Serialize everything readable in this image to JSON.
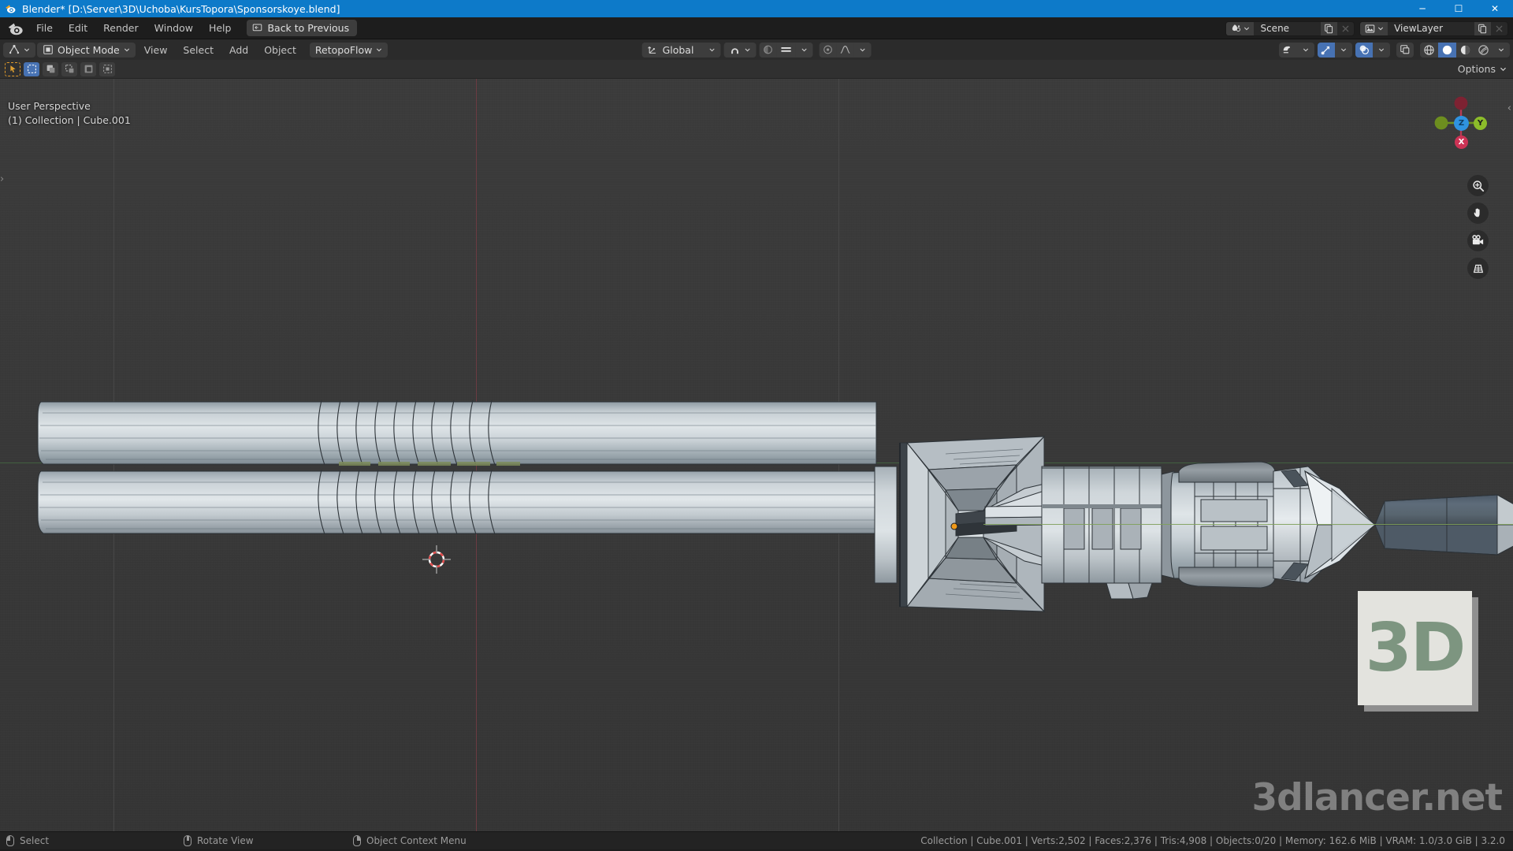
{
  "window": {
    "title": "Blender* [D:\\Server\\3D\\Uchoba\\KursTopora\\Sponsorskoye.blend]",
    "minimize": "─",
    "maximize": "☐",
    "close": "✕"
  },
  "topbar": {
    "menus": [
      "File",
      "Edit",
      "Render",
      "Window",
      "Help"
    ],
    "back_button": "Back to Previous",
    "scene": {
      "value": "Scene",
      "icon": "scene-icon"
    },
    "viewlayer": {
      "value": "ViewLayer",
      "icon": "viewlayer-icon"
    }
  },
  "viewport_header": {
    "mode": "Object Mode",
    "menus": [
      "View",
      "Select",
      "Add",
      "Object"
    ],
    "addon_menu": "RetopoFlow",
    "transform_orientation": "Global",
    "options_label": "Options"
  },
  "viewport": {
    "perspective": "User Perspective",
    "active_object": "(1) Collection | Cube.001",
    "gizmo": {
      "z": "Z",
      "y": "Y",
      "x": "X"
    },
    "nav_icons": [
      "zoom-icon",
      "pan-icon",
      "camera-icon",
      "ortho-persp-icon"
    ]
  },
  "watermark": {
    "logo_text": "3D",
    "site_text": "3dlancer.net"
  },
  "statusbar": {
    "items": [
      {
        "mouse": "left",
        "label": "Select"
      },
      {
        "mouse": "middle",
        "label": "Rotate View"
      },
      {
        "mouse": "right",
        "label": "Object Context Menu"
      }
    ],
    "stats": "Collection | Cube.001 | Verts:2,502 | Faces:2,376 | Tris:4,908 | Objects:0/20 | Memory: 162.6 MiB | VRAM: 1.0/3.0 GiB | 3.2.0"
  },
  "colors": {
    "title_bar": "#0d7ac9",
    "accent_blue": "#4772b3",
    "axis_x_red": "#6b3b42",
    "axis_y_green": "#41603f",
    "gizmo_z": "#2f93e0",
    "gizmo_y": "#8cbc2a",
    "gizmo_x": "#cc3355",
    "model_light": "#ccd2d6",
    "model_dark": "#5b6a77"
  }
}
